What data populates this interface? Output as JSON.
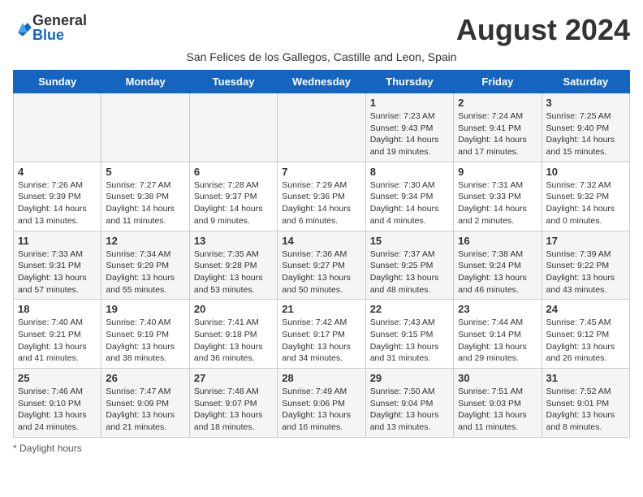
{
  "header": {
    "logo_general": "General",
    "logo_blue": "Blue",
    "month_title": "August 2024",
    "subtitle": "San Felices de los Gallegos, Castille and Leon, Spain"
  },
  "calendar": {
    "days_of_week": [
      "Sunday",
      "Monday",
      "Tuesday",
      "Wednesday",
      "Thursday",
      "Friday",
      "Saturday"
    ],
    "weeks": [
      [
        {
          "day": "",
          "info": ""
        },
        {
          "day": "",
          "info": ""
        },
        {
          "day": "",
          "info": ""
        },
        {
          "day": "",
          "info": ""
        },
        {
          "day": "1",
          "info": "Sunrise: 7:23 AM\nSunset: 9:43 PM\nDaylight: 14 hours and 19 minutes."
        },
        {
          "day": "2",
          "info": "Sunrise: 7:24 AM\nSunset: 9:41 PM\nDaylight: 14 hours and 17 minutes."
        },
        {
          "day": "3",
          "info": "Sunrise: 7:25 AM\nSunset: 9:40 PM\nDaylight: 14 hours and 15 minutes."
        }
      ],
      [
        {
          "day": "4",
          "info": "Sunrise: 7:26 AM\nSunset: 9:39 PM\nDaylight: 14 hours and 13 minutes."
        },
        {
          "day": "5",
          "info": "Sunrise: 7:27 AM\nSunset: 9:38 PM\nDaylight: 14 hours and 11 minutes."
        },
        {
          "day": "6",
          "info": "Sunrise: 7:28 AM\nSunset: 9:37 PM\nDaylight: 14 hours and 9 minutes."
        },
        {
          "day": "7",
          "info": "Sunrise: 7:29 AM\nSunset: 9:36 PM\nDaylight: 14 hours and 6 minutes."
        },
        {
          "day": "8",
          "info": "Sunrise: 7:30 AM\nSunset: 9:34 PM\nDaylight: 14 hours and 4 minutes."
        },
        {
          "day": "9",
          "info": "Sunrise: 7:31 AM\nSunset: 9:33 PM\nDaylight: 14 hours and 2 minutes."
        },
        {
          "day": "10",
          "info": "Sunrise: 7:32 AM\nSunset: 9:32 PM\nDaylight: 14 hours and 0 minutes."
        }
      ],
      [
        {
          "day": "11",
          "info": "Sunrise: 7:33 AM\nSunset: 9:31 PM\nDaylight: 13 hours and 57 minutes."
        },
        {
          "day": "12",
          "info": "Sunrise: 7:34 AM\nSunset: 9:29 PM\nDaylight: 13 hours and 55 minutes."
        },
        {
          "day": "13",
          "info": "Sunrise: 7:35 AM\nSunset: 9:28 PM\nDaylight: 13 hours and 53 minutes."
        },
        {
          "day": "14",
          "info": "Sunrise: 7:36 AM\nSunset: 9:27 PM\nDaylight: 13 hours and 50 minutes."
        },
        {
          "day": "15",
          "info": "Sunrise: 7:37 AM\nSunset: 9:25 PM\nDaylight: 13 hours and 48 minutes."
        },
        {
          "day": "16",
          "info": "Sunrise: 7:38 AM\nSunset: 9:24 PM\nDaylight: 13 hours and 46 minutes."
        },
        {
          "day": "17",
          "info": "Sunrise: 7:39 AM\nSunset: 9:22 PM\nDaylight: 13 hours and 43 minutes."
        }
      ],
      [
        {
          "day": "18",
          "info": "Sunrise: 7:40 AM\nSunset: 9:21 PM\nDaylight: 13 hours and 41 minutes."
        },
        {
          "day": "19",
          "info": "Sunrise: 7:40 AM\nSunset: 9:19 PM\nDaylight: 13 hours and 38 minutes."
        },
        {
          "day": "20",
          "info": "Sunrise: 7:41 AM\nSunset: 9:18 PM\nDaylight: 13 hours and 36 minutes."
        },
        {
          "day": "21",
          "info": "Sunrise: 7:42 AM\nSunset: 9:17 PM\nDaylight: 13 hours and 34 minutes."
        },
        {
          "day": "22",
          "info": "Sunrise: 7:43 AM\nSunset: 9:15 PM\nDaylight: 13 hours and 31 minutes."
        },
        {
          "day": "23",
          "info": "Sunrise: 7:44 AM\nSunset: 9:14 PM\nDaylight: 13 hours and 29 minutes."
        },
        {
          "day": "24",
          "info": "Sunrise: 7:45 AM\nSunset: 9:12 PM\nDaylight: 13 hours and 26 minutes."
        }
      ],
      [
        {
          "day": "25",
          "info": "Sunrise: 7:46 AM\nSunset: 9:10 PM\nDaylight: 13 hours and 24 minutes."
        },
        {
          "day": "26",
          "info": "Sunrise: 7:47 AM\nSunset: 9:09 PM\nDaylight: 13 hours and 21 minutes."
        },
        {
          "day": "27",
          "info": "Sunrise: 7:48 AM\nSunset: 9:07 PM\nDaylight: 13 hours and 18 minutes."
        },
        {
          "day": "28",
          "info": "Sunrise: 7:49 AM\nSunset: 9:06 PM\nDaylight: 13 hours and 16 minutes."
        },
        {
          "day": "29",
          "info": "Sunrise: 7:50 AM\nSunset: 9:04 PM\nDaylight: 13 hours and 13 minutes."
        },
        {
          "day": "30",
          "info": "Sunrise: 7:51 AM\nSunset: 9:03 PM\nDaylight: 13 hours and 11 minutes."
        },
        {
          "day": "31",
          "info": "Sunrise: 7:52 AM\nSunset: 9:01 PM\nDaylight: 13 hours and 8 minutes."
        }
      ]
    ]
  },
  "footer": {
    "note": "Daylight hours"
  }
}
